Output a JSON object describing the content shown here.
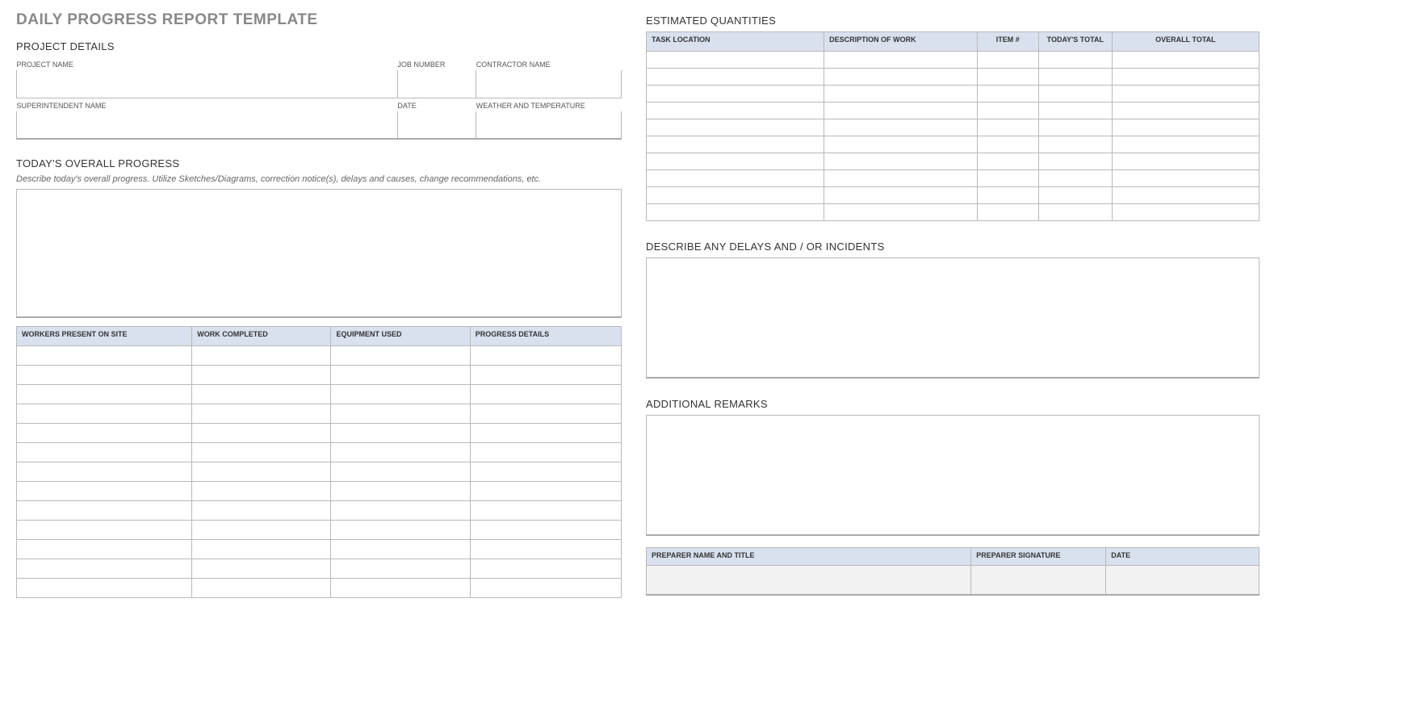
{
  "title": "DAILY PROGRESS REPORT TEMPLATE",
  "projectDetails": {
    "heading": "PROJECT DETAILS",
    "labels": {
      "projectName": "PROJECT NAME",
      "jobNumber": "JOB NUMBER",
      "contractorName": "CONTRACTOR NAME",
      "superintendentName": "SUPERINTENDENT NAME",
      "date": "DATE",
      "weather": "WEATHER AND TEMPERATURE"
    },
    "values": {
      "projectName": "",
      "jobNumber": "",
      "contractorName": "",
      "superintendentName": "",
      "date": "",
      "weather": ""
    }
  },
  "overallProgress": {
    "heading": "TODAY'S OVERALL PROGRESS",
    "description": "Describe today's overall progress.  Utilize Sketches/Diagrams, correction notice(s), delays and causes, change recommendations, etc.",
    "value": ""
  },
  "progressTable": {
    "headers": {
      "workers": "WORKERS PRESENT ON SITE",
      "completed": "WORK COMPLETED",
      "equipment": "EQUIPMENT USED",
      "details": "PROGRESS DETAILS"
    },
    "rows": [
      {
        "workers": "",
        "completed": "",
        "equipment": "",
        "details": ""
      },
      {
        "workers": "",
        "completed": "",
        "equipment": "",
        "details": ""
      },
      {
        "workers": "",
        "completed": "",
        "equipment": "",
        "details": ""
      },
      {
        "workers": "",
        "completed": "",
        "equipment": "",
        "details": ""
      },
      {
        "workers": "",
        "completed": "",
        "equipment": "",
        "details": ""
      },
      {
        "workers": "",
        "completed": "",
        "equipment": "",
        "details": ""
      },
      {
        "workers": "",
        "completed": "",
        "equipment": "",
        "details": ""
      },
      {
        "workers": "",
        "completed": "",
        "equipment": "",
        "details": ""
      },
      {
        "workers": "",
        "completed": "",
        "equipment": "",
        "details": ""
      },
      {
        "workers": "",
        "completed": "",
        "equipment": "",
        "details": ""
      },
      {
        "workers": "",
        "completed": "",
        "equipment": "",
        "details": ""
      },
      {
        "workers": "",
        "completed": "",
        "equipment": "",
        "details": ""
      },
      {
        "workers": "",
        "completed": "",
        "equipment": "",
        "details": ""
      }
    ]
  },
  "estimatedQuantities": {
    "heading": "ESTIMATED QUANTITIES",
    "headers": {
      "taskLocation": "TASK LOCATION",
      "description": "DESCRIPTION OF WORK",
      "item": "ITEM #",
      "today": "TODAY'S TOTAL",
      "overall": "OVERALL TOTAL"
    },
    "rows": [
      {
        "taskLocation": "",
        "description": "",
        "item": "",
        "today": "",
        "overall": ""
      },
      {
        "taskLocation": "",
        "description": "",
        "item": "",
        "today": "",
        "overall": ""
      },
      {
        "taskLocation": "",
        "description": "",
        "item": "",
        "today": "",
        "overall": ""
      },
      {
        "taskLocation": "",
        "description": "",
        "item": "",
        "today": "",
        "overall": ""
      },
      {
        "taskLocation": "",
        "description": "",
        "item": "",
        "today": "",
        "overall": ""
      },
      {
        "taskLocation": "",
        "description": "",
        "item": "",
        "today": "",
        "overall": ""
      },
      {
        "taskLocation": "",
        "description": "",
        "item": "",
        "today": "",
        "overall": ""
      },
      {
        "taskLocation": "",
        "description": "",
        "item": "",
        "today": "",
        "overall": ""
      },
      {
        "taskLocation": "",
        "description": "",
        "item": "",
        "today": "",
        "overall": ""
      },
      {
        "taskLocation": "",
        "description": "",
        "item": "",
        "today": "",
        "overall": ""
      }
    ]
  },
  "delays": {
    "heading": "DESCRIBE ANY DELAYS AND / OR INCIDENTS",
    "value": ""
  },
  "remarks": {
    "heading": "ADDITIONAL REMARKS",
    "value": ""
  },
  "signature": {
    "headers": {
      "preparer": "PREPARER NAME AND TITLE",
      "sig": "PREPARER SIGNATURE",
      "date": "DATE"
    },
    "values": {
      "preparer": "",
      "sig": "",
      "date": ""
    }
  }
}
